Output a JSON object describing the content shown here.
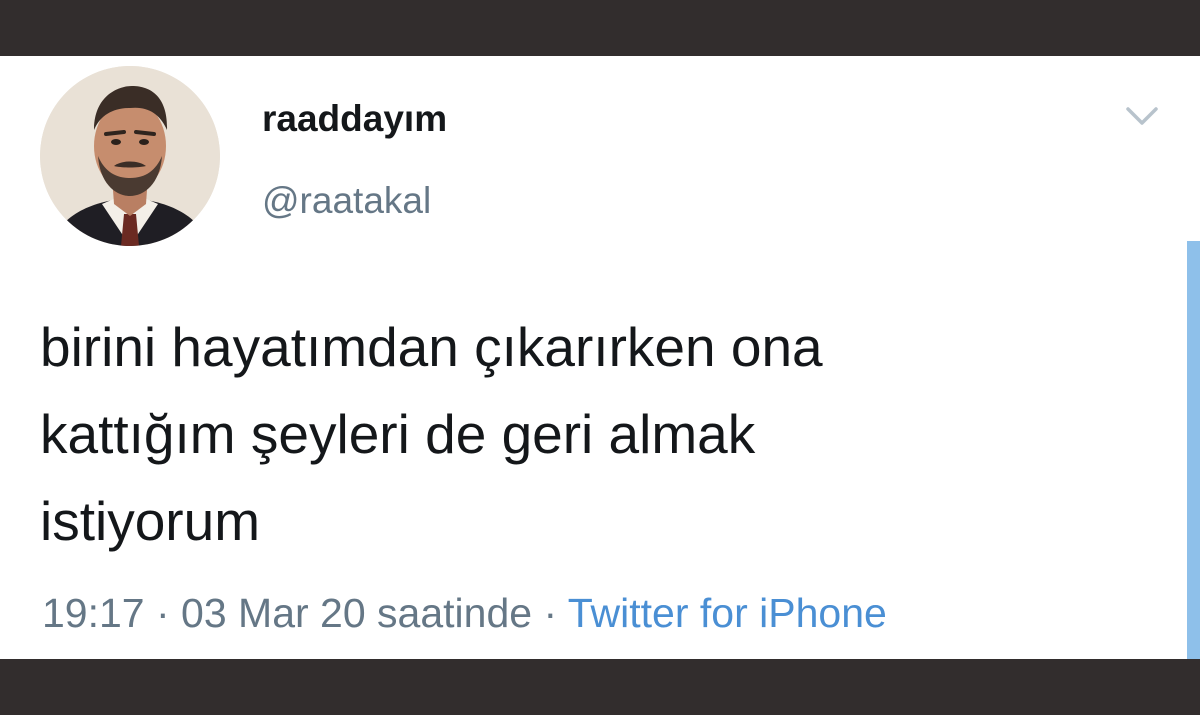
{
  "tweet": {
    "display_name": "raaddayım",
    "handle": "@raatakal",
    "text_lines": [
      "birini hayatımdan çıkarırken ona",
      "kattığım şeyleri de geri almak",
      "istiyorum"
    ],
    "time": "19:17",
    "separator": " · ",
    "date": "03 Mar 20 saatinde",
    "source": "Twitter for iPhone"
  },
  "icons": {
    "menu": "chevron-down-icon",
    "avatar": "profile-photo"
  },
  "colors": {
    "frame": "#322d2d",
    "text_primary": "#14171a",
    "text_secondary": "#657786",
    "link": "#4a8fd4",
    "scroll_indicator": "#8ec0ea"
  }
}
